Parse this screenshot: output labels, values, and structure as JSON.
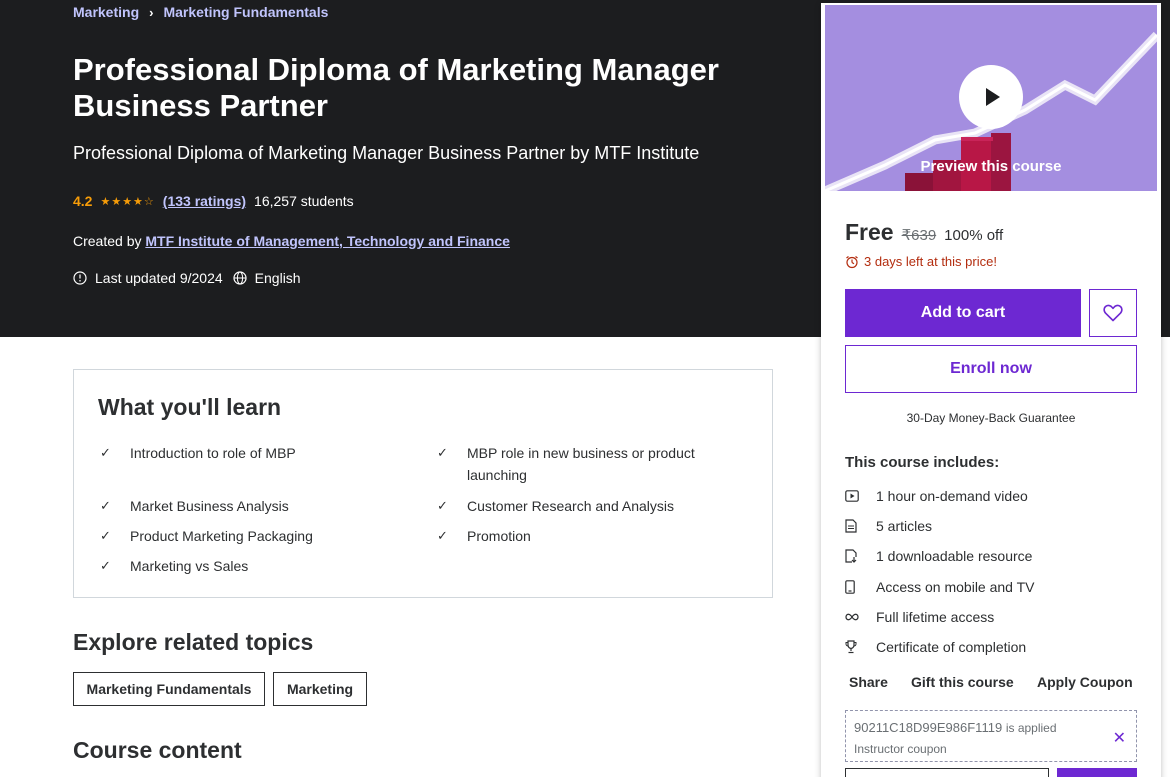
{
  "breadcrumb": [
    "Marketing",
    "Marketing Fundamentals"
  ],
  "course": {
    "title": "Professional Diploma of Marketing Manager Business Partner",
    "subtitle": "Professional Diploma of Marketing Manager Business Partner by MTF Institute",
    "rating": "4.2",
    "rating_value": 4.2,
    "ratings_count": "(133 ratings)",
    "students": "16,257 students",
    "created_by_label": "Created by",
    "instructor": "MTF Institute of Management, Technology and Finance",
    "last_updated": "Last updated 9/2024",
    "language": "English"
  },
  "learn": {
    "title": "What you'll learn",
    "items": [
      "Introduction to role of MBP",
      "MBP role in new business or product launching",
      "Market Business Analysis",
      "Customer Research and Analysis",
      "Product Marketing Packaging",
      "Promotion",
      "Marketing vs Sales"
    ]
  },
  "related": {
    "title": "Explore related topics",
    "topics": [
      "Marketing Fundamentals",
      "Marketing"
    ]
  },
  "course_content_title": "Course content",
  "sidebar": {
    "preview_label": "Preview this course",
    "price": "Free",
    "original_price": "₹639",
    "discount": "100% off",
    "timer": "3 days left at this price!",
    "add_to_cart": "Add to cart",
    "enroll_now": "Enroll now",
    "guarantee": "30-Day Money-Back Guarantee",
    "includes_title": "This course includes:",
    "includes": [
      {
        "icon": "video-icon",
        "label": "1 hour on-demand video"
      },
      {
        "icon": "article-icon",
        "label": "5 articles"
      },
      {
        "icon": "download-file-icon",
        "label": "1 downloadable resource"
      },
      {
        "icon": "mobile-icon",
        "label": "Access on mobile and TV"
      },
      {
        "icon": "infinity-icon",
        "label": "Full lifetime access"
      },
      {
        "icon": "trophy-icon",
        "label": "Certificate of completion"
      }
    ],
    "links": {
      "share": "Share",
      "gift": "Gift this course",
      "coupon": "Apply Coupon"
    },
    "coupon": {
      "code": "90211C18D99E986F1119",
      "applied": "is applied",
      "type": "Instructor coupon"
    }
  },
  "colors": {
    "hero_bg": "#1c1d1f",
    "accent_purple": "#6d28d2",
    "link_lavender": "#c0c4fc",
    "star_orange": "#f69c08",
    "timer_red": "#b32d0f",
    "preview_bg": "#a48ee0"
  }
}
